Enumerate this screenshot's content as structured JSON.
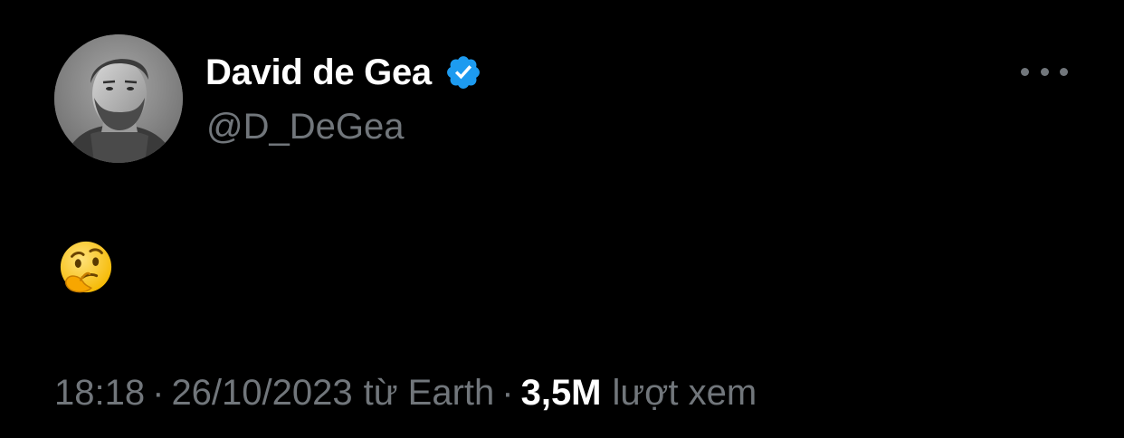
{
  "tweet": {
    "author": {
      "display_name": "David de Gea",
      "handle": "@D_DeGea",
      "verified": true,
      "avatar_icon": "profile-photo"
    },
    "more_icon": "more-horizontal-icon",
    "text_emoji": "thinking-face-emoji",
    "meta": {
      "time": "18:18",
      "separator": "·",
      "date": "26/10/2023",
      "source": "từ Earth",
      "views_count": "3,5M",
      "views_label": "lượt xem"
    },
    "colors": {
      "background": "#000000",
      "name": "#ffffff",
      "secondary": "#71767b",
      "verified": "#1d9bf0"
    }
  }
}
